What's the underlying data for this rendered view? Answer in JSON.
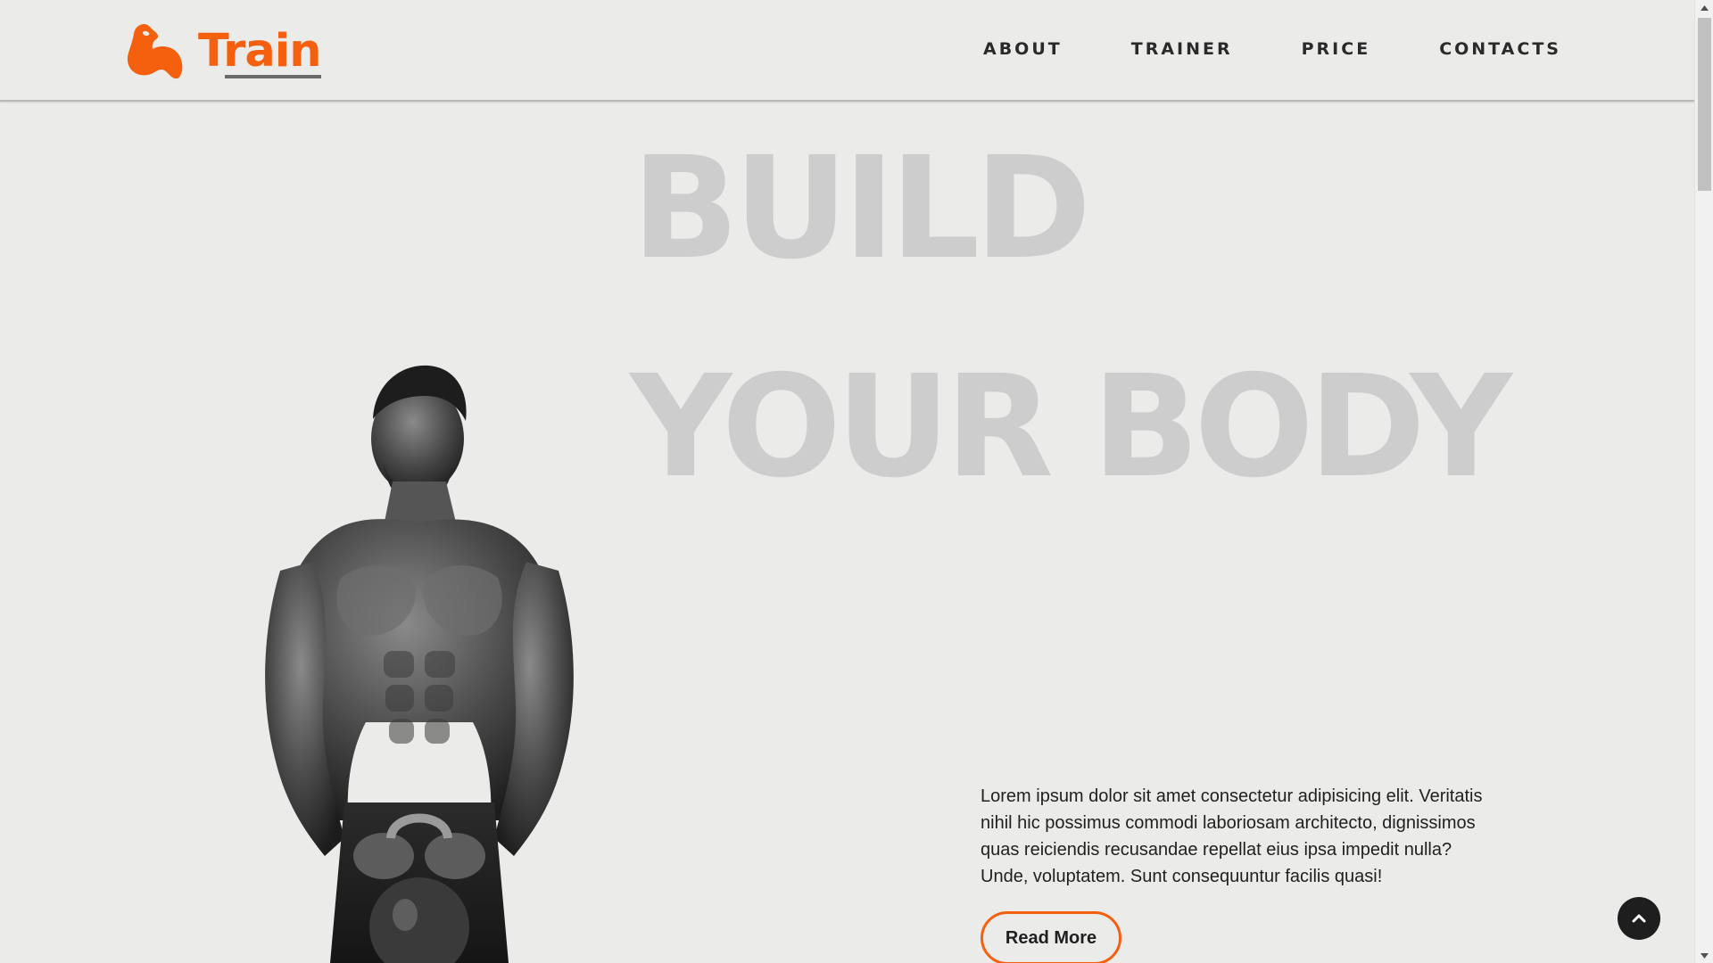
{
  "brand": {
    "name": "Train",
    "accent_color": "#f5600f",
    "icon": "flexed-bicep-icon"
  },
  "nav": {
    "items": [
      {
        "label": "ABOUT"
      },
      {
        "label": "TRAINER"
      },
      {
        "label": "PRICE"
      },
      {
        "label": "CONTACTS"
      }
    ]
  },
  "hero": {
    "line1": "BUILD",
    "line2": "YOUR BODY",
    "image": "muscular-man-holding-kettlebell"
  },
  "intro": {
    "text": "Lorem ipsum dolor sit amet consectetur adipisicing elit. Veritatis nihil hic possimus commodi laboriosam architecto, dignissimos quas reiciendis recusandae repellat eius ipsa impedit nulla? Unde, voluptatem. Sunt consequuntur facilis quasi!",
    "button_label": "Read More"
  },
  "back_to_top": {
    "icon": "chevron-up-icon"
  }
}
